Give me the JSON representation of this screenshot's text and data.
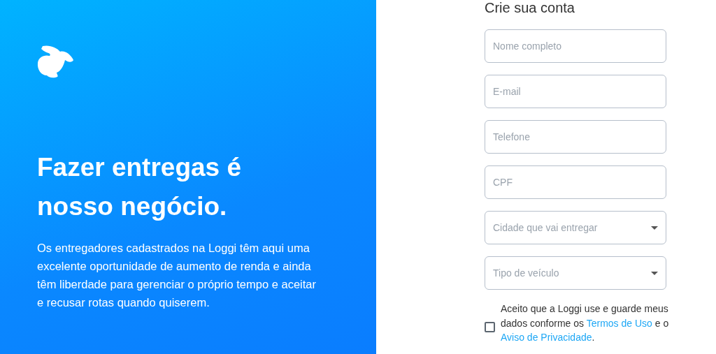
{
  "hero": {
    "headline": "Fazer entregas é nosso negócio.",
    "description": "Os entregadores cadastrados na Loggi têm aqui uma excelente oportunidade de aumento de renda e ainda têm liberdade para gerenciar o próprio tempo e aceitar e recusar rotas quando quiserem."
  },
  "form": {
    "title": "Crie sua conta",
    "fields": [
      {
        "kind": "text",
        "placeholder": "Nome completo"
      },
      {
        "kind": "text",
        "placeholder": "E-mail"
      },
      {
        "kind": "text",
        "placeholder": "Telefone"
      },
      {
        "kind": "text",
        "placeholder": "CPF"
      },
      {
        "kind": "select",
        "placeholder": "Cidade que vai entregar"
      },
      {
        "kind": "select",
        "placeholder": "Tipo de veículo"
      }
    ],
    "consent": {
      "checked": false,
      "parts": [
        {
          "kind": "text",
          "text": "Aceito que a Loggi use e guarde meus dados conforme os "
        },
        {
          "kind": "link",
          "text": "Termos de Uso"
        },
        {
          "kind": "text",
          "text": " e o "
        },
        {
          "kind": "link",
          "text": "Aviso de Privacidade"
        },
        {
          "kind": "text",
          "text": "."
        }
      ]
    }
  }
}
